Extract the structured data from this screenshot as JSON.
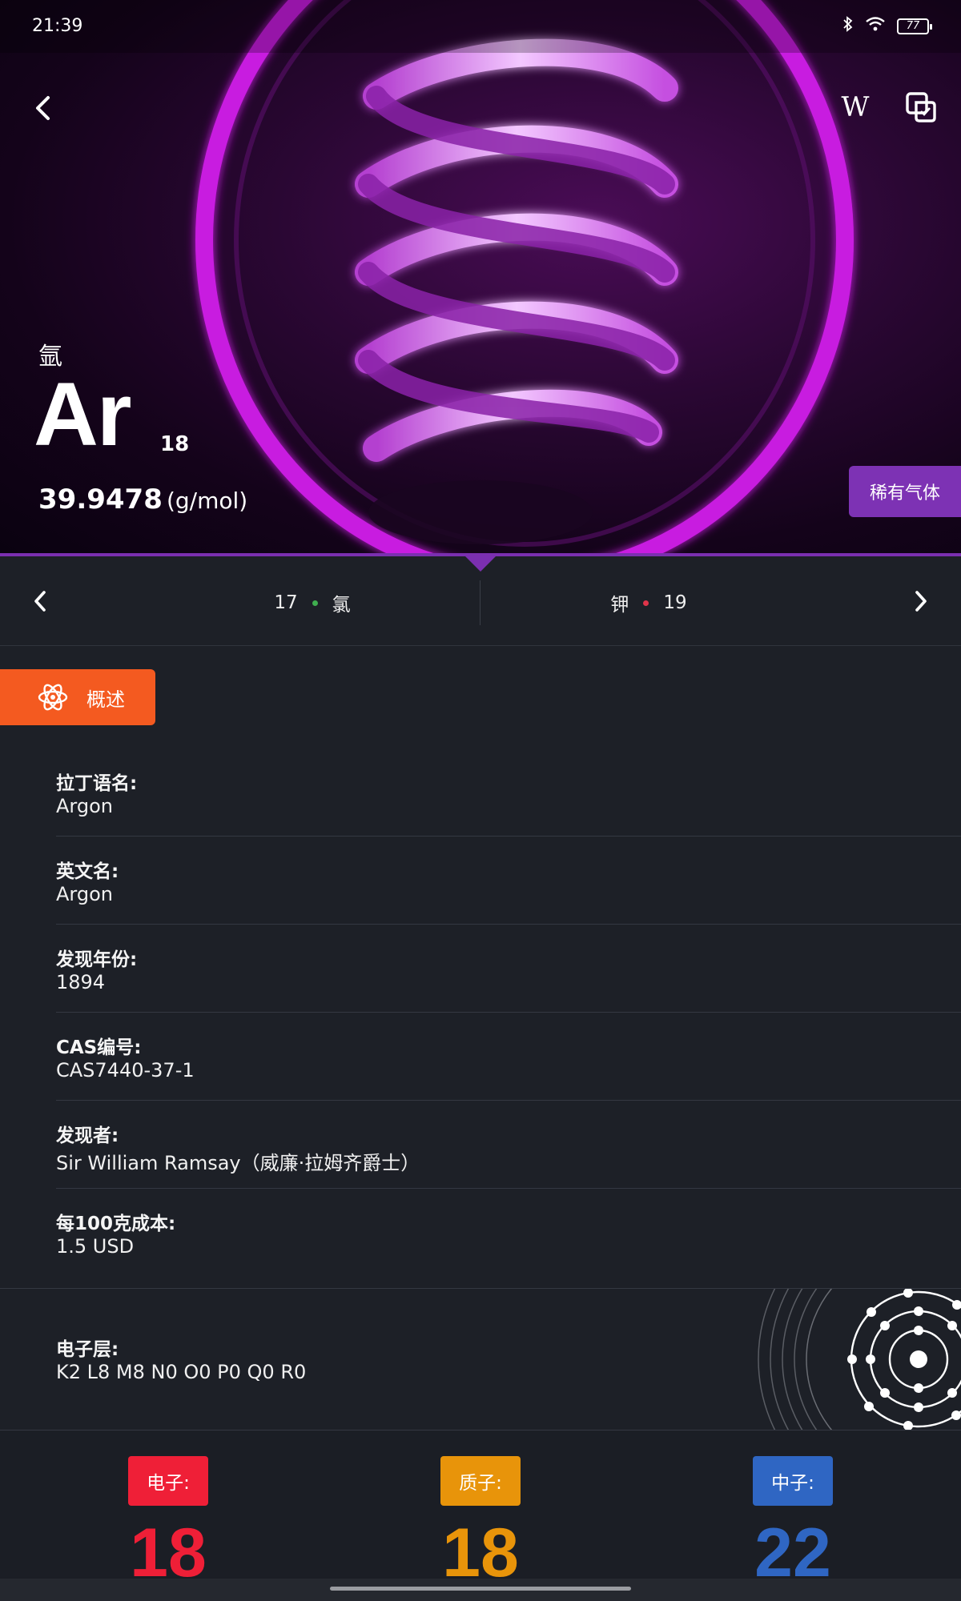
{
  "status_bar": {
    "time": "21:39",
    "battery": "77",
    "icons": [
      "bluetooth-icon",
      "wifi-icon",
      "battery-icon"
    ]
  },
  "header": {
    "back_icon": "chevron-left-icon",
    "wiki_label": "W",
    "copy_icon": "copy-icon"
  },
  "element": {
    "name_cn": "氩",
    "symbol": "Ar",
    "atomic_number": "18",
    "mass": "39.9478",
    "mass_unit": "(g/mol)",
    "category": "稀有气体",
    "category_color": "#7d32b4"
  },
  "neighbors": {
    "prev": {
      "number": "17",
      "name": "氯",
      "dot_color": "#3fae4f"
    },
    "next": {
      "number": "19",
      "name": "钾",
      "dot_color": "#e0344a"
    }
  },
  "tab": {
    "label": "概述",
    "icon": "atom-icon",
    "color": "#f45a20"
  },
  "info": [
    {
      "label": "拉丁语名:",
      "value": "Argon"
    },
    {
      "label": "英文名:",
      "value": "Argon"
    },
    {
      "label": "发现年份:",
      "value": "1894"
    },
    {
      "label": "CAS编号:",
      "value": "CAS7440-37-1"
    },
    {
      "label": "发现者:",
      "value": "Sir William Ramsay（威廉·拉姆齐爵士）"
    },
    {
      "label": "每100克成本:",
      "value": "1.5 USD"
    }
  ],
  "electron_shells": {
    "label": "电子层:",
    "value": "K2 L8 M8 N0 O0 P0 Q0 R0"
  },
  "particles": {
    "electrons": {
      "label": "电子:",
      "value": "18",
      "color": "#ef1f37"
    },
    "protons": {
      "label": "质子:",
      "value": "18",
      "color": "#e8940a"
    },
    "neutrons": {
      "label": "中子:",
      "value": "22",
      "color": "#2f66c3"
    }
  }
}
